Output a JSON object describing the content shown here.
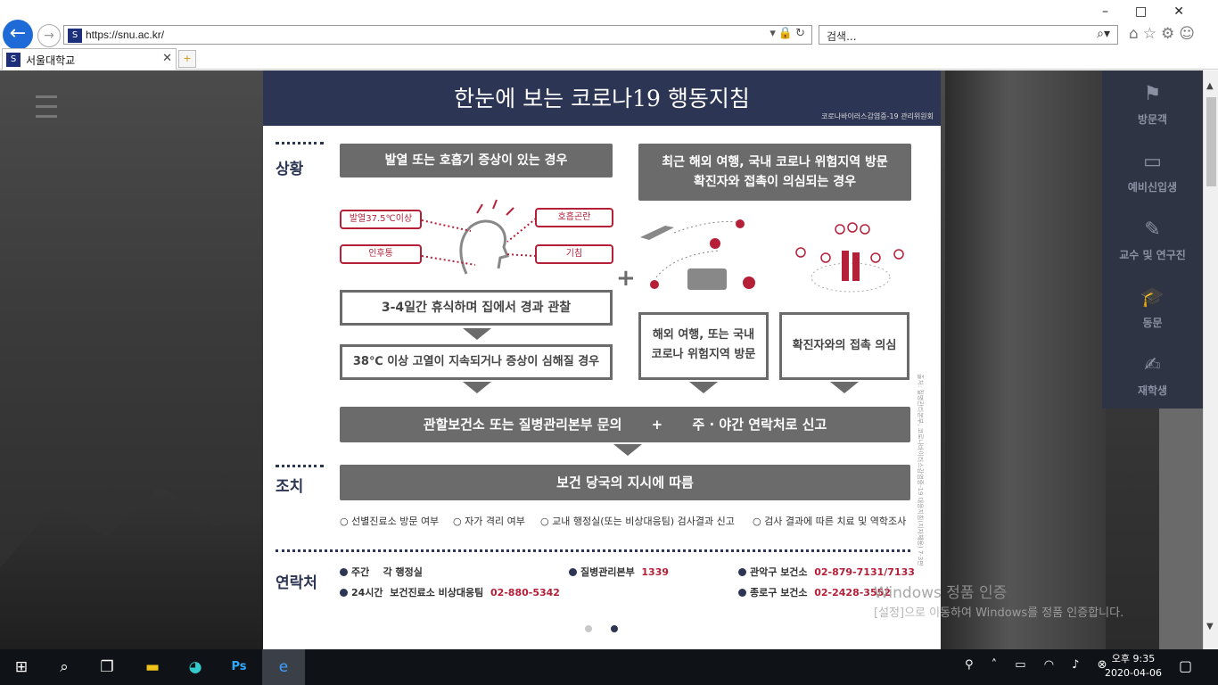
{
  "browser": {
    "url": "https://snu.ac.kr/",
    "search_placeholder": "검색...",
    "tab_title": "서울대학교"
  },
  "sidenav": [
    {
      "label": "방문객",
      "icon": "signpost-icon"
    },
    {
      "label": "예비신입생",
      "icon": "id-card-icon"
    },
    {
      "label": "교수 및 연구진",
      "icon": "pen-icon"
    },
    {
      "label": "동문",
      "icon": "graduation-cap-icon"
    },
    {
      "label": "재학생",
      "icon": "student-icon"
    }
  ],
  "card": {
    "title": "한눈에 보는 코로나19 행동지침",
    "subtitle": "코로나바이러스감염증-19 관리위원회",
    "section_situation": "상황",
    "section_action": "조치",
    "section_contact": "연락처",
    "left_head": "발열 또는 호흡기 증상이 있는 경우",
    "symptoms": [
      "발열37.5℃이상",
      "호흡곤란",
      "인후통",
      "기침"
    ],
    "left_step1": "3-4일간 휴식하며 집에서 경과 관찰",
    "left_step2": "38℃ 이상 고열이 지속되거나 증상이 심해질 경우",
    "plus": "+",
    "right_head_1": "최근 해외 여행, 국내 코로나 위험지역 방문",
    "right_head_2": "확진자와 접촉이 의심되는 경우",
    "travel_1": "해외 여행, 또는 국내",
    "travel_2": "코로나 위험지역 방문",
    "contact_box": "확진자와의 접촉 의심",
    "report_1": "관할보건소 또는 질병관리본부 문의",
    "report_plus": "+",
    "report_2": "주 · 야간 연락처로 신고",
    "action": "보건 당국의 지시에 따름",
    "checks": [
      "선별진료소 방문 여부",
      "자가 격리 여부",
      "교내 행정실(또는 비상대응팀) 검사결과 신고",
      "검사 결과에 따른 치료 및 역학조사"
    ],
    "contacts": {
      "day_label": "주간",
      "day_name": "각 행정실",
      "all_label": "24시간",
      "all_name": "보건진료소 비상대응팀",
      "all_num": "02-880-5342",
      "kcdc_name": "질병관리본부",
      "kcdc_num": "1339",
      "gwanak_name": "관악구 보건소",
      "gwanak_num": "02-879-7131/7133",
      "jongno_name": "종로구 보건소",
      "jongno_num": "02-2428-3552"
    },
    "source_note": "출처: 질병관리본부, 코로나바이러스감염증-19 대응지침(지자체용) 7-3판"
  },
  "watermark": {
    "line1": "Windows 정품 인증",
    "line2": "[설정]으로 이동하여 Windows를 정품 인증합니다."
  },
  "clock": {
    "time": "오후 9:35",
    "date": "2020-04-06"
  },
  "colors": {
    "navy": "#2c3553",
    "red": "#b51f38",
    "gray": "#6b6b6b"
  }
}
